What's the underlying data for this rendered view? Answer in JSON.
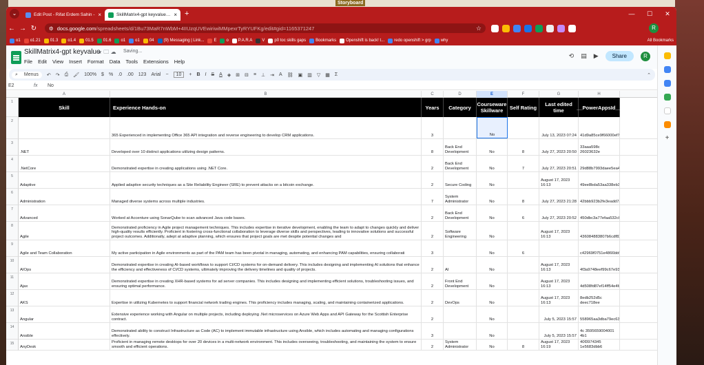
{
  "overlay": {
    "label": "Storyboard"
  },
  "browser": {
    "tabs": [
      {
        "title": "Edit Post - Rifat Erdem Sahin -",
        "active": false
      },
      {
        "title": "SkillMatrix4-gpt keyvalue - Go",
        "active": true
      }
    ],
    "new_tab": "+",
    "url_host": "docs.google.com",
    "url_path": "/spreadsheets/d/1Bu73MaR7nWbM+4IIUzqUVEwiriwiMMpexrTyRYUFKg/edit#gid=1165371247",
    "bookmarks": [
      "o1",
      "o1.21",
      "01.3",
      "o1.4",
      "01.5",
      "01.6",
      "o1",
      "o1",
      "04",
      "(9) Messaging | Link...",
      "E",
      "o",
      "P.A.R.A",
      "V",
      "p0 toc skills gaps",
      "Bookmarks",
      "Openshift is back! t...",
      "redo openshift > grp",
      "why"
    ],
    "all_bookmarks": "All Bookmarks",
    "profile": "R"
  },
  "sheet": {
    "title": "SkillMatrix4-gpt keyvalue",
    "saving": "Saving...",
    "menus": [
      "File",
      "Edit",
      "View",
      "Insert",
      "Format",
      "Data",
      "Tools",
      "Extensions",
      "Help"
    ],
    "toolbar": {
      "search": "Menus",
      "zoom": "100%",
      "currency": "$",
      "percent": "%",
      "dec1": ".0",
      "dec2": ".00",
      "fmt": "123",
      "font": "Arial",
      "size": "10"
    },
    "share": "Share",
    "avatar": "R",
    "cell_ref": "E2",
    "formula": "No",
    "columns": [
      "A",
      "B",
      "C",
      "D",
      "E",
      "F",
      "G",
      "H"
    ],
    "headers": [
      "Skill",
      "Experience Hands-on",
      "Years",
      "Category",
      "Courseware Skillware",
      "Self Rating",
      "Last edited time",
      "__PowerAppsId__"
    ],
    "rows": [
      {
        "n": "2",
        "cells": [
          "",
          "365 Experienced in implementing Office 365 API integration and reverse engineering to develop CRM applications.",
          "3",
          "",
          "No",
          "",
          "July 13, 2023 07:24",
          "41d9a85ce9f66000ef76"
        ]
      },
      {
        "n": "3",
        "cells": [
          ".NET",
          "Developed over 10 distinct applications utilizing design patterns.",
          "8",
          "Back End Development",
          "No",
          "8",
          "July 27, 2023 20:50",
          "33aaa598c 26023632e"
        ]
      },
      {
        "n": "4",
        "cells": [
          ".NetCore",
          "Demonstrated expertise in creating applications using .NET Core.",
          "2",
          "Back End Development",
          "No",
          "7",
          "July 27, 2023 20:51",
          "29d88b7993daee5ea43"
        ]
      },
      {
        "n": "5",
        "cells": [
          "Adaptive",
          "Applied adaptive security techniques as a Site Reliability Engineer (SRE) to prevent attacks on a bitcoin exchange.",
          "2",
          "Secure Coding",
          "No",
          "",
          "August 17, 2023 16:13",
          "49ee8bda53aa338eb340"
        ]
      },
      {
        "n": "6",
        "cells": [
          "Administration",
          "Managed diverse systems across multiple industries.",
          "7",
          "System Administrator",
          "No",
          "8",
          "July 27, 2023 21:28",
          "42bbb923b2fe3eadd7a8"
        ]
      },
      {
        "n": "7",
        "cells": [
          "Advanced",
          "Worked at Accenture using SonarQube to scan advanced Java code bases.",
          "2",
          "Back End Development",
          "No",
          "6",
          "July 27, 2023 20:52",
          "450dbc3a77efaa532c09"
        ]
      },
      {
        "n": "8",
        "cells": [
          "Agile",
          "Demonstrated proficiency in Agile project management techniques. This includes expertise in iterative development, enabling the team to adapt to changes quickly and deliver high-quality results efficiently. Proficient in fostering cross-functional collaboration to leverage diverse skills and perspectives, leading to innovative solutions and successful project outcomes. Additionally, adept at adaptive planning, which ensures that project goals are met despite potential changes and",
          "2",
          "Software Engineering",
          "No",
          "",
          "August 17, 2023 16:13",
          "436084883807b6cdf82"
        ]
      },
      {
        "n": "9",
        "cells": [
          "Agile and Team Collaboration",
          "My active participation in Agile environments as part of the PAM team has been pivotal in managing, automating, and enhancing PAM capabilities, ensuring collaborati",
          "3",
          "",
          "No",
          "6",
          "",
          "c42969f0751e4866bb5ec9fbce"
        ]
      },
      {
        "n": "10",
        "cells": [
          "AIOps",
          "Demonstrated expertise in creating AI-based workflows to support CI/CD systems for on-demand delivery. This includes designing and implementing AI solutions that enhance the efficiency and effectiveness of CI/CD systems, ultimately improving the delivery timelines and quality of projects.",
          "2",
          "AI",
          "No",
          "",
          "August 17, 2023 16:13",
          "4f3a9748eef99c67e93c"
        ]
      },
      {
        "n": "11",
        "cells": [
          "Ajax",
          "Demonstrated expertise in creating XHR-based systems for ad server companies. This includes designing and implementing efficient solutions, troubleshooting issues, and ensuring optimal performance.",
          "2",
          "Front End Development",
          "No",
          "",
          "August 17, 2023 16:13",
          "4d508fd87ef14ff54e4fab"
        ]
      },
      {
        "n": "12",
        "cells": [
          "AKS",
          "Expertise in utilizing Kubernetes to support financial network trading engines. This proficiency includes managing, scaling, and maintaining containerized applications.",
          "2",
          "DevOps",
          "No",
          "",
          "August 17, 2023 16:13",
          "8edb252d5c deec718ee"
        ]
      },
      {
        "n": "13",
        "cells": [
          "Angular",
          "Extensive experience working with Angular on multiple projects, including deploying .Net microservices on Azure Web Apps and API Gateway for the Scottish Enterprise contract.",
          "2",
          "",
          "No",
          "",
          "July 5, 2023 15:57",
          "558965aa3dba79ec637"
        ]
      },
      {
        "n": "14",
        "cells": [
          "Ansible",
          "Demonstrated ability to construct Infrastructure as Code (AC) to implement immutable infrastructure using Ansible, which includes automating and managing configurations effectively.",
          "3",
          "",
          "No",
          "",
          "July 5, 2023 15:57",
          "4c 3595659004001 4b1"
        ]
      },
      {
        "n": "15",
        "cells": [
          "AnyDesk",
          "Proficient in managing remote desktops for over 20 devices in a multi-network environment. This includes overseeing, troubleshooting, and maintaining the system to ensure smooth and efficient operations.",
          "2",
          "System Administrator",
          "No",
          "8",
          "August 17, 2023 16:19",
          "40f3974345 1e5683dbb6"
        ]
      }
    ]
  }
}
